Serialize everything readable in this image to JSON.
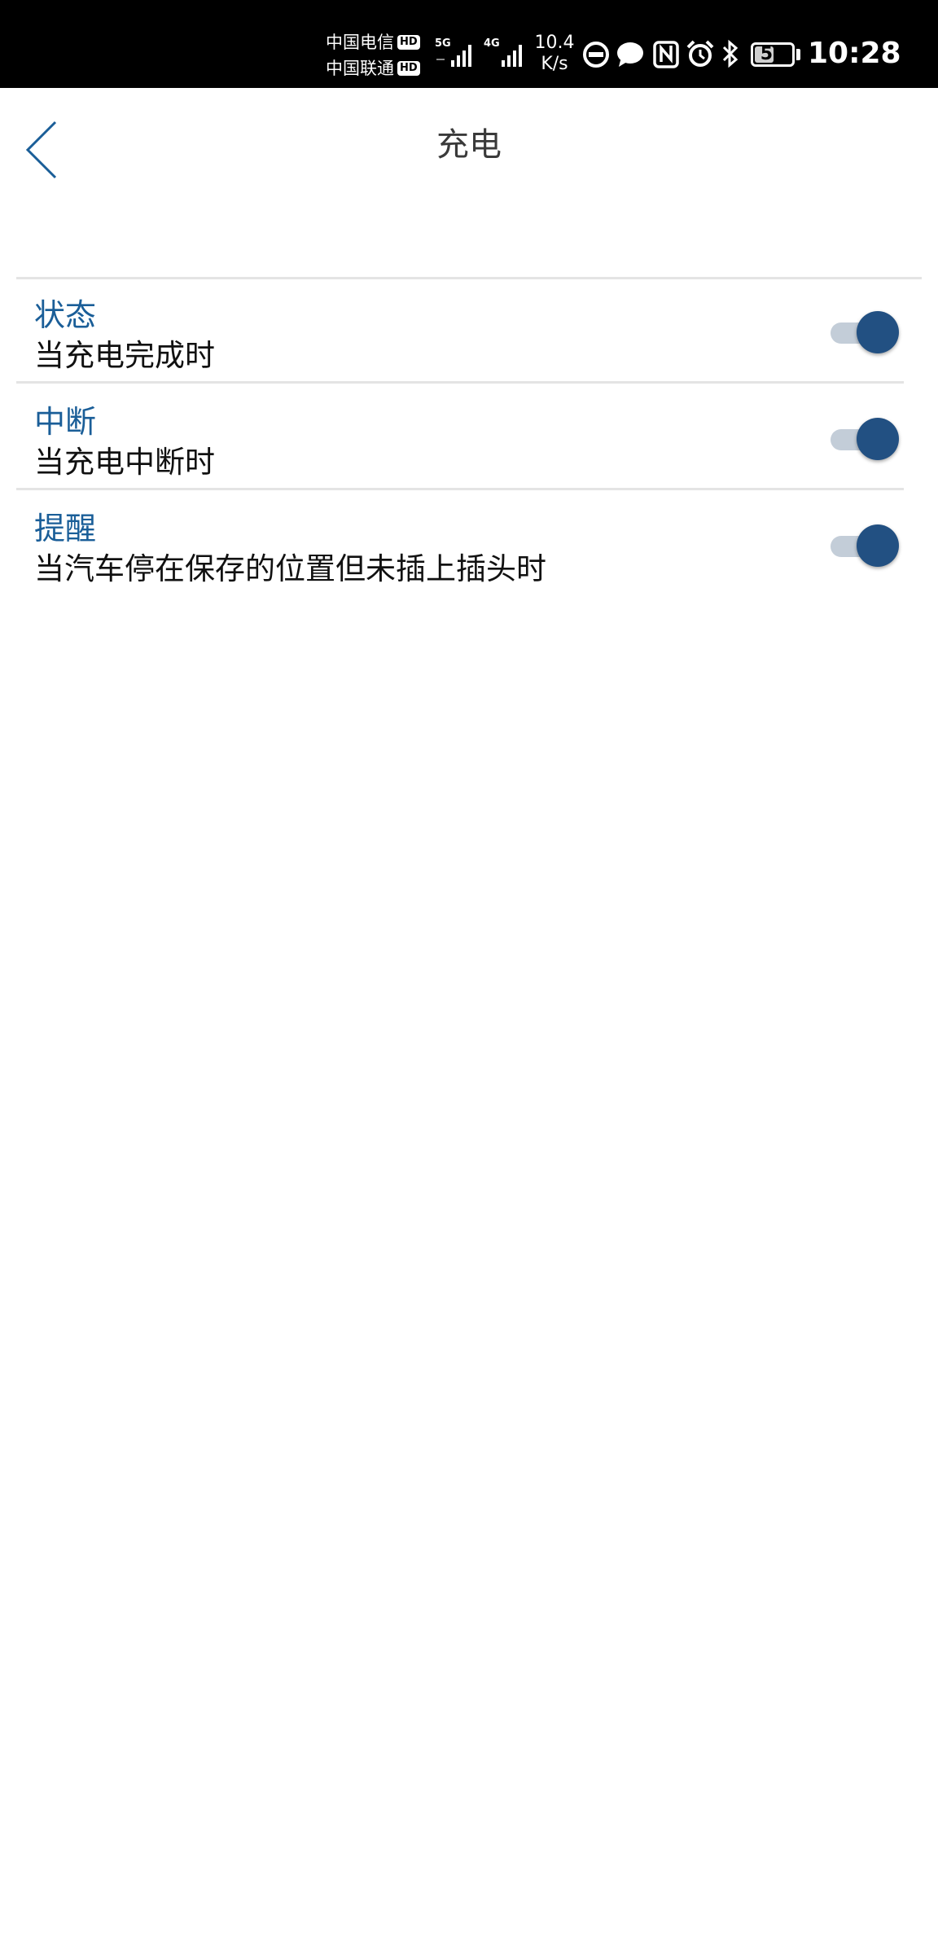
{
  "status_bar": {
    "carrier_1": "中国电信",
    "carrier_2": "中国联通",
    "hd_label": "HD",
    "net_1": "5G",
    "net_2": "4G",
    "speed_value": "10.4",
    "speed_unit": "K/s",
    "battery": "52",
    "battery_level": 0.52,
    "time": "10:28"
  },
  "header": {
    "title": "充电"
  },
  "settings": [
    {
      "title": "状态",
      "description": "当充电完成时",
      "enabled": true
    },
    {
      "title": "中断",
      "description": "当充电中断时",
      "enabled": true
    },
    {
      "title": "提醒",
      "description": "当汽车停在保存的位置但未插上插头时",
      "enabled": true
    }
  ],
  "colors": {
    "accent": "#1a5e98",
    "toggle_knob": "#225082",
    "toggle_track": "#c3cdd8",
    "divider": "#e4e4e4"
  }
}
